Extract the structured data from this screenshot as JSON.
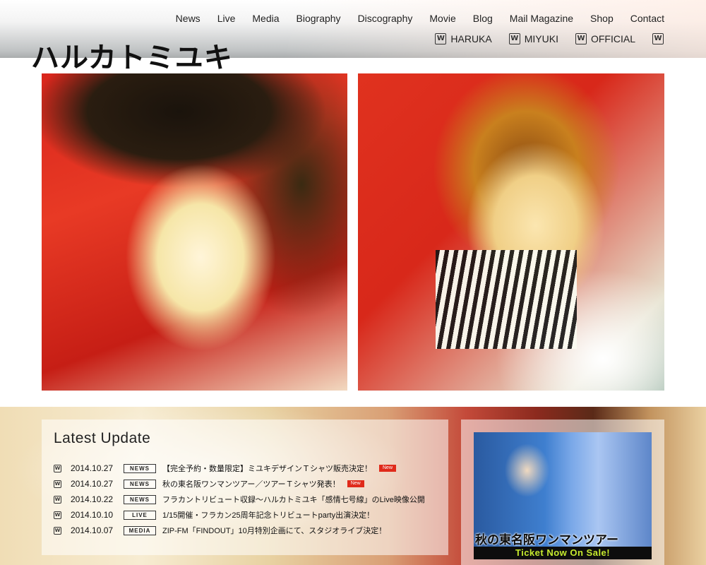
{
  "site": {
    "logo": "ハルカトミユキ"
  },
  "nav": {
    "items": [
      "News",
      "Live",
      "Media",
      "Biography",
      "Discography",
      "Movie",
      "Blog",
      "Mail Magazine",
      "Shop",
      "Contact"
    ]
  },
  "subnav": {
    "items": [
      "HARUKA",
      "MIYUKI",
      "OFFICIAL",
      ""
    ],
    "icon_glyph": "W"
  },
  "updates": {
    "title": "Latest Update",
    "items": [
      {
        "date": "2014.10.27",
        "tag": "NEWS",
        "text": "【完全予約・数量限定】ミユキデザインＴシャツ販売決定！",
        "new": "New"
      },
      {
        "date": "2014.10.27",
        "tag": "NEWS",
        "text": "秋の東名阪ワンマンツアー／ツアーＴシャツ発表！",
        "new": "New"
      },
      {
        "date": "2014.10.22",
        "tag": "NEWS",
        "text": "フラカントリビュート収録～ハルカトミユキ「感情七号線」のLive映像公開",
        "new": null
      },
      {
        "date": "2014.10.10",
        "tag": "LIVE",
        "text": "1/15開催・フラカン25周年記念トリビュートparty出演決定！",
        "new": null
      },
      {
        "date": "2014.10.07",
        "tag": "MEDIA",
        "text": "ZIP-FM「FINDOUT」10月特別企画にて、スタジオライブ決定！",
        "new": null
      }
    ]
  },
  "promo": {
    "title": "秋の東名阪ワンマンツアー",
    "cta": "Ticket Now On Sale!"
  },
  "colors": {
    "new_badge": "#e02a1a",
    "ticket_text": "#c6ea2e"
  }
}
